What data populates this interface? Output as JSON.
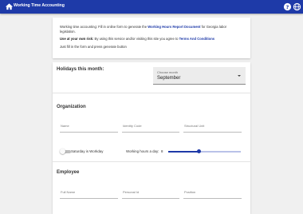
{
  "appbar": {
    "title": "Working Time Accounting",
    "home_icon": "home-icon",
    "help_icon": "help-icon",
    "language_icon": "globe-icon"
  },
  "intro": {
    "line1_pre": "Working time accounting: Fill in online form to generate the ",
    "line1_link": "Working Hours Report Document",
    "line1_post": " for Georgia labor",
    "line2": "legislation.",
    "risk_bold": "Use at your own risk:",
    "risk_text": " By using this service and/or visiting this site you agree to ",
    "terms_link": "Terms And Conditions",
    "instruction": "Just fill in the form and press generate button"
  },
  "holidays": {
    "title": "Holidays this month:",
    "month_label": "Choose month",
    "month_value": "September"
  },
  "organization": {
    "title": "Organization",
    "name_placeholder": "Name",
    "identity_code_placeholder": "Identity Code",
    "structural_unit_placeholder": "Structural Unit",
    "saturday_label": "Saturday is Workday",
    "saturday_on": false,
    "hours_label": "Working hours a day:",
    "hours_value": "8",
    "hours_fraction": 0.42
  },
  "employee": {
    "title": "Employee",
    "fullname_placeholder": "Full Name",
    "personal_id_placeholder": "Personal Id",
    "position_placeholder": "Position"
  },
  "colors": {
    "primary": "#1e3aa8",
    "background": "#f0f0f0"
  }
}
